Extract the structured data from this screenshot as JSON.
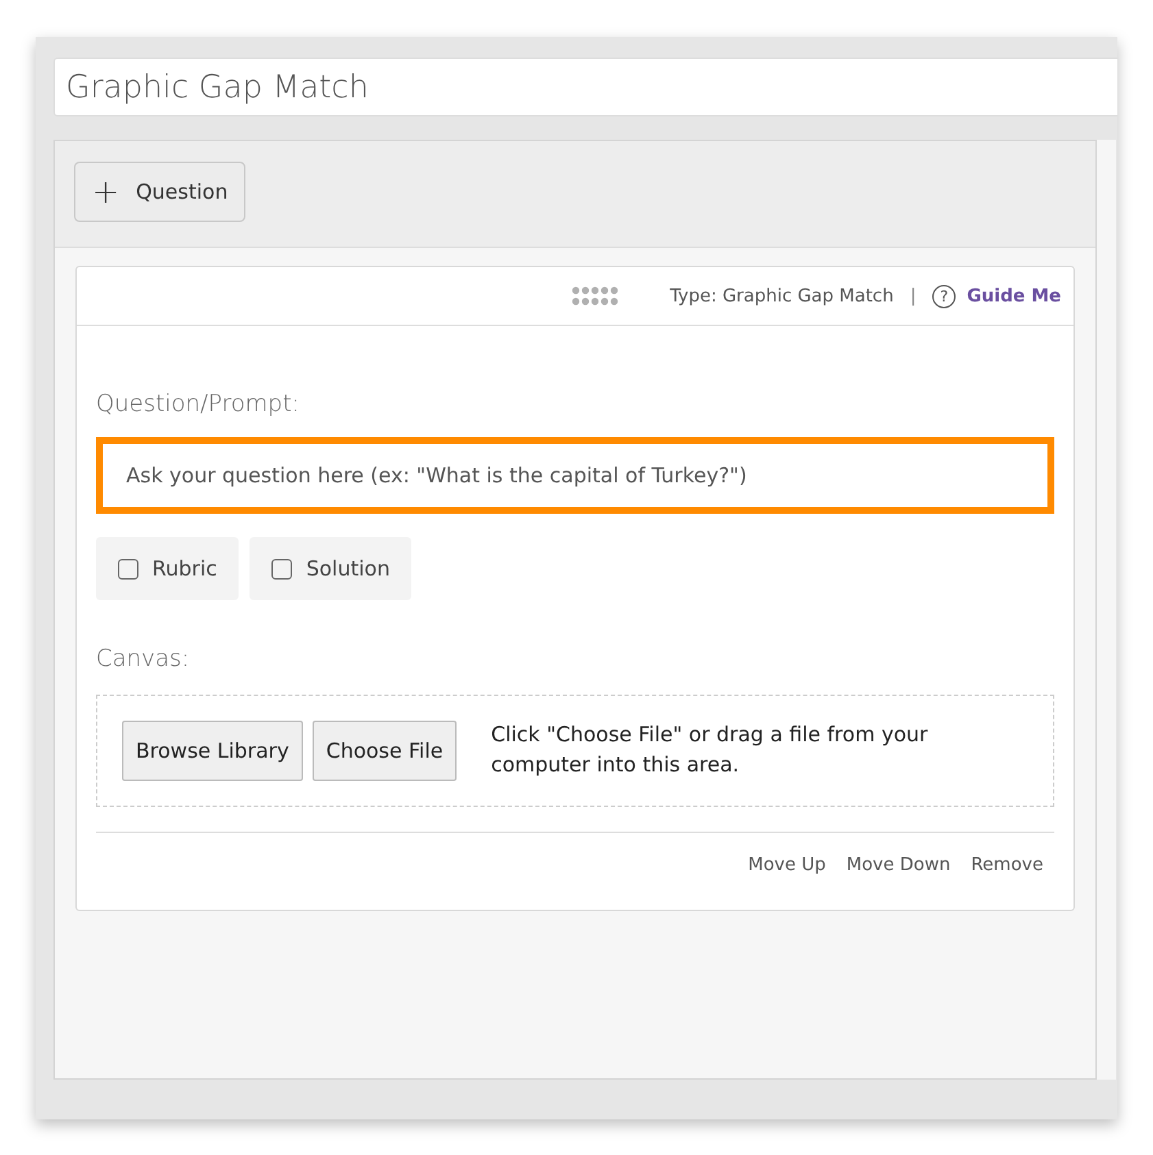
{
  "title_field": {
    "value": "Graphic Gap Match"
  },
  "add_button": {
    "icon": "+",
    "label": "Question"
  },
  "question_card": {
    "type_label": "Type: Graphic Gap Match",
    "separator": "|",
    "help_icon": "?",
    "guide_link": "Guide Me",
    "prompt_label": "Question/Prompt:",
    "prompt_field": {
      "placeholder": "Ask your question here (ex: \"What is the capital of Turkey?\")",
      "focused": true
    },
    "options": [
      {
        "label": "Rubric",
        "checked": false
      },
      {
        "label": "Solution",
        "checked": false
      }
    ],
    "canvas_label": "Canvas:",
    "canvas_buttons": [
      "Browse Library",
      "Choose File"
    ],
    "canvas_hint": "Click \"Choose File\" or drag a file from your computer into this area.",
    "actions": [
      "Move Up",
      "Move Down",
      "Remove"
    ]
  }
}
